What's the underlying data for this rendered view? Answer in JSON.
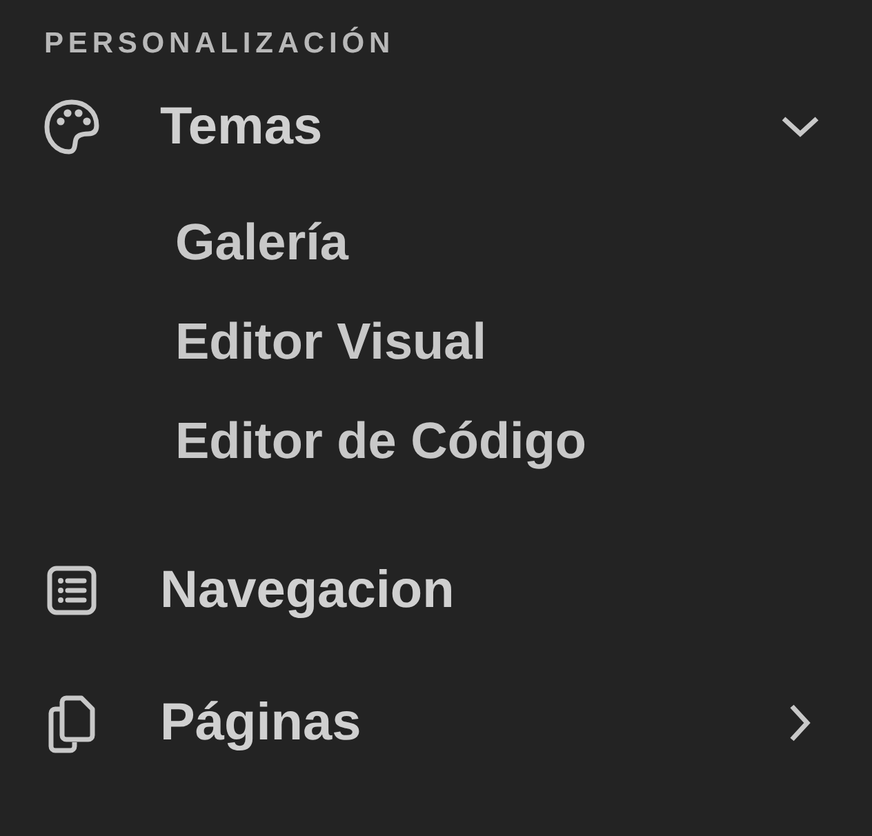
{
  "section": {
    "title": "PERSONALIZACIÓN"
  },
  "items": [
    {
      "label": "Temas",
      "kind": "palette",
      "expandable": true,
      "expanded": true,
      "children": [
        {
          "label": "Galería"
        },
        {
          "label": "Editor Visual"
        },
        {
          "label": "Editor de Código"
        }
      ]
    },
    {
      "label": "Navegacion",
      "kind": "list",
      "expandable": false
    },
    {
      "label": "Páginas",
      "kind": "pages",
      "expandable": true,
      "expanded": false
    }
  ]
}
